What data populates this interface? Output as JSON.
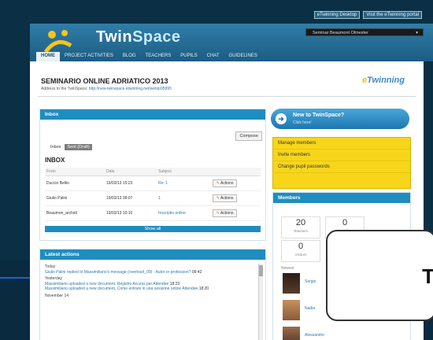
{
  "top_links": [
    "eTwinning Desktop",
    "Visit the eTwinning portal"
  ],
  "header": {
    "brand_twin": "Twin",
    "brand_space": "Space",
    "user_menu": "Seminar Beaumont Olmester",
    "nav": [
      "HOME",
      "PROJECT ACTIVITIES",
      "BLOG",
      "TEACHERS",
      "PUPILS",
      "CHAT",
      "GUIDELINES"
    ]
  },
  "page": {
    "title": "SEMINARIO ONLINE ADRIATICO 2013",
    "url_prefix": "Address to the TwinSpace:",
    "url": "http://new-twinspace.etwinning.net/web/p95995",
    "logo_e": "e",
    "logo_text": "Twinning"
  },
  "inbox": {
    "panel_title": "Inbox",
    "compose": "Compose",
    "tabs": [
      "Inbox",
      "Sent (Draft)"
    ],
    "heading": "INBOX",
    "columns": [
      "From",
      "Date",
      "Subject",
      ""
    ],
    "rows": [
      {
        "from": "Duccio Bellio",
        "date": "19/03/13 15:23",
        "subject": "Re: 1",
        "action": "Actions"
      },
      {
        "from": "Giulio Palini",
        "date": "19/03/13 09:07",
        "subject": "1",
        "action": "Actions"
      },
      {
        "from": "Beaumon_archstl",
        "date": "19/03/13 10:10",
        "subject": "Inscriptio online",
        "action": "Actions"
      }
    ],
    "show_all": "Show all"
  },
  "activity": {
    "panel_title": "Latest actions",
    "lines": [
      {
        "type": "day",
        "text": "Today"
      },
      {
        "type": "item",
        "text": "Giulio Palini replied to Massimiliano's message (overtourl_09) - Autor or profession?",
        "time": "09:42"
      },
      {
        "type": "day",
        "text": "Yesterday"
      },
      {
        "type": "item",
        "text": "Massimiliano uploaded a new document, Registro Access per Attendee",
        "time": "18:23"
      },
      {
        "type": "item",
        "text": "Massimiliano uploaded a new document, Come entrare in una sessione online Attendee",
        "time": "18:20"
      },
      {
        "type": "day",
        "text": "November 14"
      }
    ]
  },
  "new_twinspace": {
    "title": "New to TwinSpace?",
    "subtitle": "Click here!"
  },
  "admin_links": [
    "Manage members",
    "Invite members",
    "Change pupil passwords"
  ],
  "members": {
    "panel_title": "Members",
    "stats": [
      {
        "value": "20",
        "label": "Teachers"
      },
      {
        "value": "0",
        "label": "Pupils"
      },
      {
        "value": "0",
        "label": "Visitors"
      }
    ],
    "sort_label": "Newest",
    "names": [
      "Sergio",
      "Nadia",
      "Alessandro"
    ]
  },
  "callout": {
    "glyph": "T"
  }
}
